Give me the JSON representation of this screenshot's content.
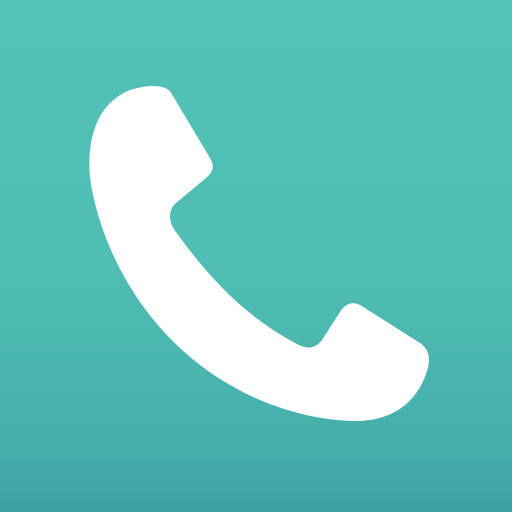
{
  "app_icon": {
    "name": "phone-icon",
    "colors": {
      "background_top": "#52c2b6",
      "background_bottom": "#3b9ea3",
      "glyph": "#ffffff"
    }
  }
}
